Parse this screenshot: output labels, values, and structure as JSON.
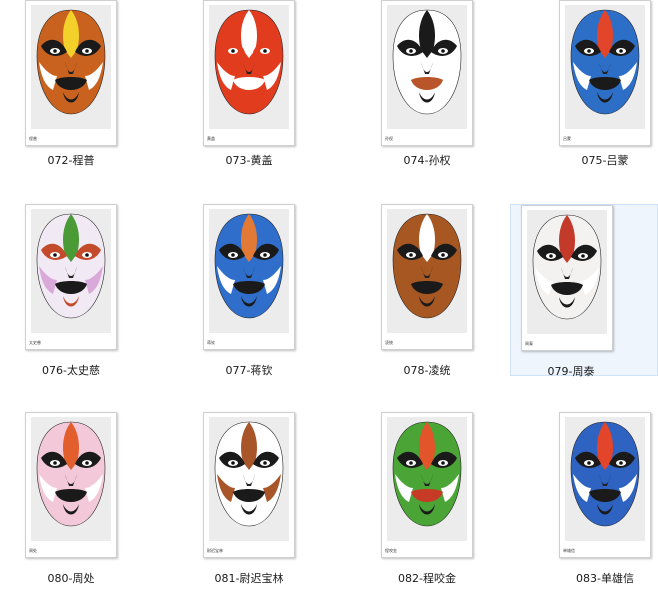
{
  "files": [
    {
      "label": "072-程普",
      "caption": "程普",
      "selected": false,
      "colors": {
        "base": "#c9621f",
        "accent": "#f4d12a",
        "band": "#1a1a1a",
        "side": "#ffffff",
        "mouth": "#1a1a1a"
      }
    },
    {
      "label": "073-黄盖",
      "caption": "黄盖",
      "selected": false,
      "colors": {
        "base": "#e23c1f",
        "accent": "#ffffff",
        "band": "#e23c1f",
        "side": "#ffffff",
        "mouth": "#ffffff"
      }
    },
    {
      "label": "074-孙权",
      "caption": "孙权",
      "selected": false,
      "colors": {
        "base": "#ffffff",
        "accent": "#1a1a1a",
        "band": "#1a1a1a",
        "side": "#ffffff",
        "mouth": "#b8562a"
      }
    },
    {
      "label": "075-吕蒙",
      "caption": "吕蒙",
      "selected": false,
      "colors": {
        "base": "#2d6ec7",
        "accent": "#e2452a",
        "band": "#1a1a1a",
        "side": "#ffffff",
        "mouth": "#1a1a1a"
      }
    },
    {
      "label": "076-太史慈",
      "caption": "太史慈",
      "selected": false,
      "colors": {
        "base": "#f1e9f3",
        "accent": "#4a9a36",
        "band": "#c34a2a",
        "side": "#d9a9d9",
        "mouth": "#1a1a1a"
      }
    },
    {
      "label": "077-蒋钦",
      "caption": "蒋钦",
      "selected": false,
      "colors": {
        "base": "#2f6fcb",
        "accent": "#e27a35",
        "band": "#1a1a1a",
        "side": "#ffffff",
        "mouth": "#1a1a1a"
      }
    },
    {
      "label": "078-凌统",
      "caption": "凌统",
      "selected": false,
      "colors": {
        "base": "#a65722",
        "accent": "#ffffff",
        "band": "#1a1a1a",
        "side": "#a65722",
        "mouth": "#1a1a1a"
      }
    },
    {
      "label": "079-周泰",
      "caption": "周泰",
      "selected": true,
      "colors": {
        "base": "#f4f2f1",
        "accent": "#c43a2a",
        "band": "#1a1a1a",
        "side": "#ffffff",
        "mouth": "#1a1a1a"
      }
    },
    {
      "label": "080-周处",
      "caption": "周处",
      "selected": false,
      "colors": {
        "base": "#f3c9d9",
        "accent": "#e25e2c",
        "band": "#1a1a1a",
        "side": "#ffffff",
        "mouth": "#1a1a1a"
      }
    },
    {
      "label": "081-尉迟宝林",
      "caption": "尉迟宝林",
      "selected": false,
      "colors": {
        "base": "#ffffff",
        "accent": "#a9552a",
        "band": "#1a1a1a",
        "side": "#a9552a",
        "mouth": "#1a1a1a"
      }
    },
    {
      "label": "082-程咬金",
      "caption": "程咬金",
      "selected": false,
      "colors": {
        "base": "#4aa536",
        "accent": "#e2542a",
        "band": "#1a1a1a",
        "side": "#ffffff",
        "mouth": "#c73a26"
      }
    },
    {
      "label": "083-单雄信",
      "caption": "单雄信",
      "selected": false,
      "colors": {
        "base": "#2e63c2",
        "accent": "#e2452a",
        "band": "#1a1a1a",
        "side": "#ffffff",
        "mouth": "#1a1a1a"
      }
    }
  ]
}
